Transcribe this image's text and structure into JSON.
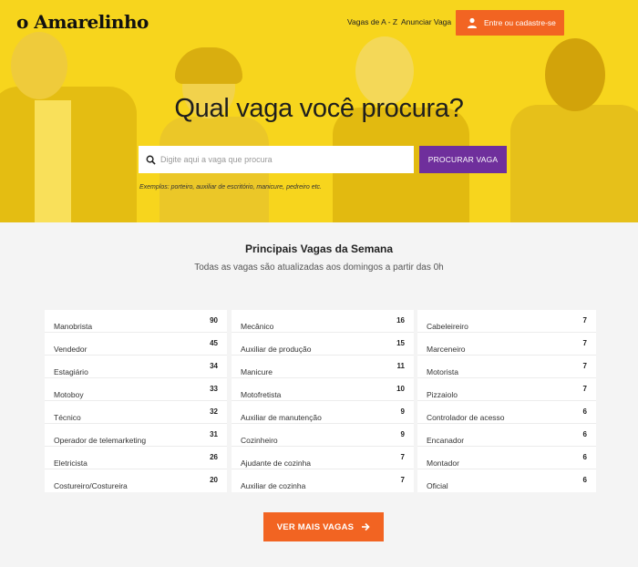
{
  "header": {
    "logo": "o Amarelinho",
    "nav": [
      {
        "label": "Vagas de A - Z"
      },
      {
        "label": "Anunciar Vaga"
      }
    ],
    "login_button": "Entre ou cadastre-se",
    "login_icon": "user-icon"
  },
  "hero": {
    "title": "Qual vaga você procura?",
    "search_placeholder": "Digite aqui a vaga que procura",
    "search_value": "",
    "search_icon": "search-icon",
    "search_button": "PROCURAR VAGA",
    "examples": "Exemplos: porteiro, auxiliar de escritório, manicure, pedreiro etc."
  },
  "main": {
    "title": "Principais Vagas da Semana",
    "subtitle": "Todas as vagas são atualizadas aos domingos a partir das 0h",
    "columns": [
      [
        {
          "name": "Manobrista",
          "count": "90"
        },
        {
          "name": "Vendedor",
          "count": "45"
        },
        {
          "name": "Estagiário",
          "count": "34"
        },
        {
          "name": "Motoboy",
          "count": "33"
        },
        {
          "name": "Técnico",
          "count": "32"
        },
        {
          "name": "Operador de telemarketing",
          "count": "31"
        },
        {
          "name": "Eletricista",
          "count": "26"
        },
        {
          "name": "Costureiro/Costureira",
          "count": "20"
        }
      ],
      [
        {
          "name": "Mecânico",
          "count": "16"
        },
        {
          "name": "Auxiliar de produção",
          "count": "15"
        },
        {
          "name": "Manicure",
          "count": "11"
        },
        {
          "name": "Motofretista",
          "count": "10"
        },
        {
          "name": "Auxiliar de manutenção",
          "count": "9"
        },
        {
          "name": "Cozinheiro",
          "count": "9"
        },
        {
          "name": "Ajudante de cozinha",
          "count": "7"
        },
        {
          "name": "Auxiliar de cozinha",
          "count": "7"
        }
      ],
      [
        {
          "name": "Cabeleireiro",
          "count": "7"
        },
        {
          "name": "Marceneiro",
          "count": "7"
        },
        {
          "name": "Motorista",
          "count": "7"
        },
        {
          "name": "Pizzaiolo",
          "count": "7"
        },
        {
          "name": "Controlador de acesso",
          "count": "6"
        },
        {
          "name": "Encanador",
          "count": "6"
        },
        {
          "name": "Montador",
          "count": "6"
        },
        {
          "name": "Oficial",
          "count": "6"
        }
      ]
    ],
    "more_button": "VER MAIS VAGAS",
    "more_icon": "arrow-right-icon"
  },
  "colors": {
    "hero_yellow": "#f7d51d",
    "accent_orange": "#f26422",
    "search_purple": "#6f2f9c",
    "background": "#f4f4f4"
  }
}
